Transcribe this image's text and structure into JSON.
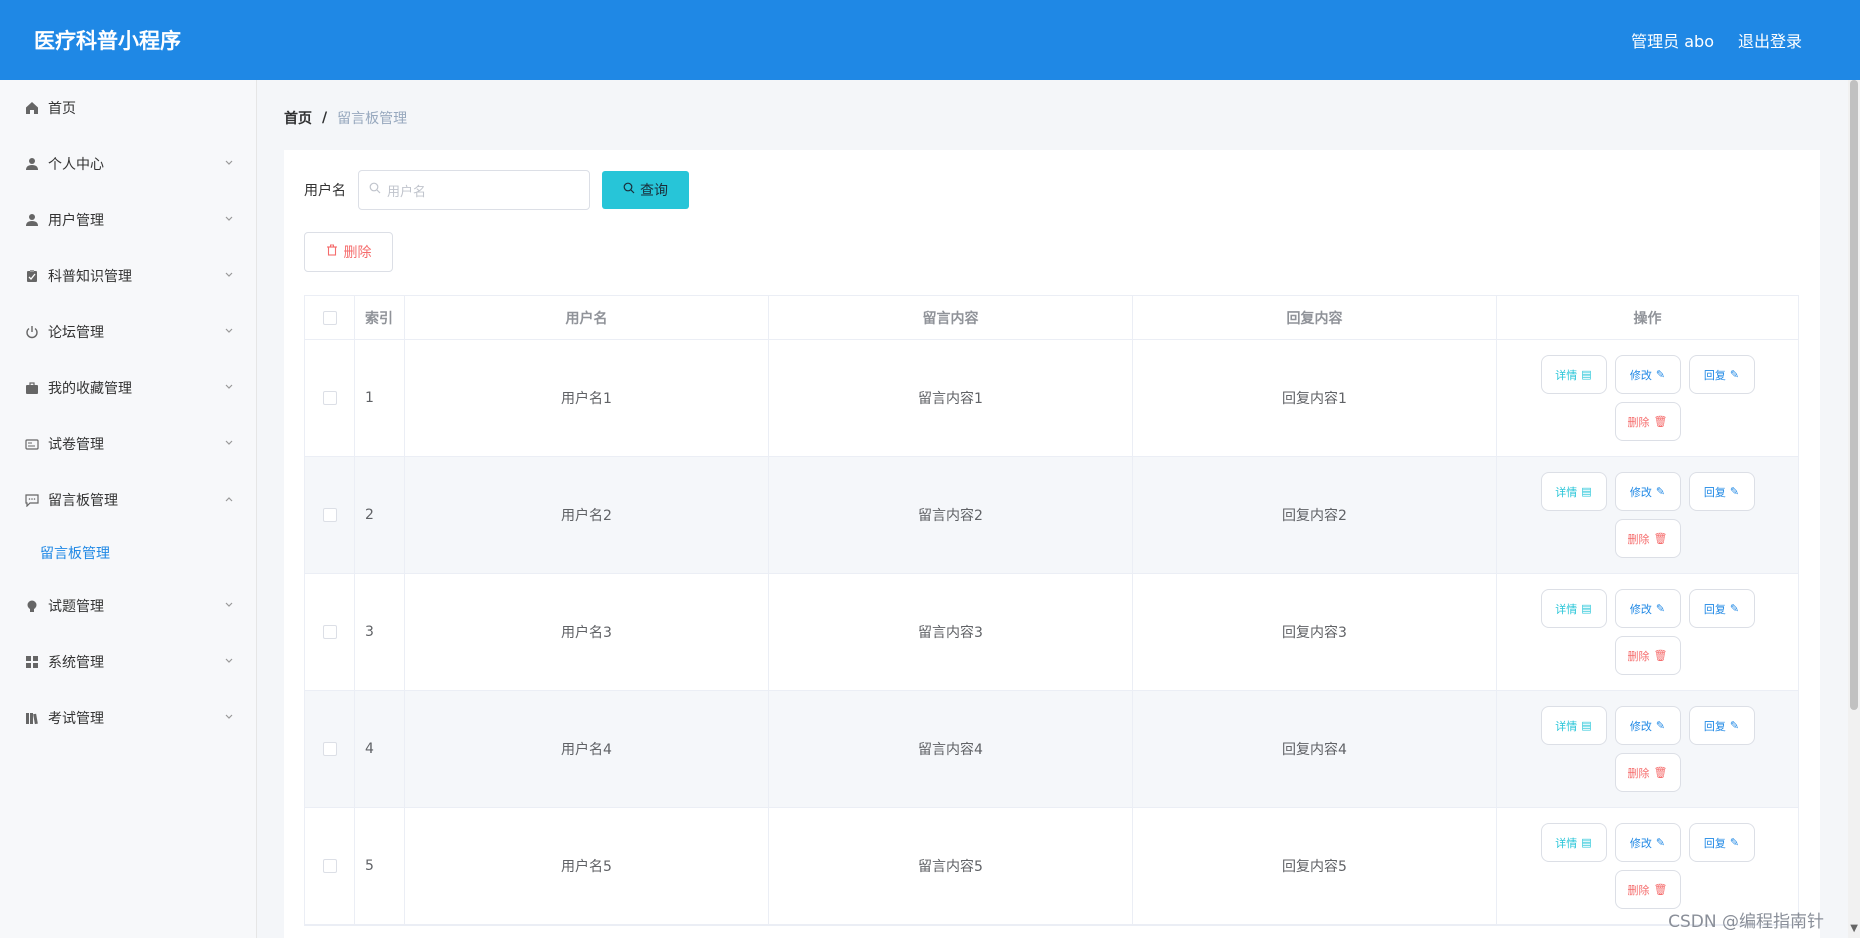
{
  "header": {
    "title": "医疗科普小程序",
    "admin": "管理员 abo",
    "logout": "退出登录"
  },
  "sidebar": {
    "items": [
      {
        "label": "首页",
        "icon": "home-icon"
      },
      {
        "label": "个人中心",
        "icon": "user-icon"
      },
      {
        "label": "用户管理",
        "icon": "user-icon"
      },
      {
        "label": "科普知识管理",
        "icon": "clipboard-icon"
      },
      {
        "label": "论坛管理",
        "icon": "power-icon"
      },
      {
        "label": "我的收藏管理",
        "icon": "briefcase-icon"
      },
      {
        "label": "试卷管理",
        "icon": "card-icon"
      },
      {
        "label": "留言板管理",
        "icon": "chat-icon"
      },
      {
        "label": "试题管理",
        "icon": "bulb-icon"
      },
      {
        "label": "系统管理",
        "icon": "grid-icon"
      },
      {
        "label": "考试管理",
        "icon": "books-icon"
      }
    ],
    "submenu": {
      "label": "留言板管理"
    }
  },
  "breadcrumb": {
    "home": "首页",
    "separator": "/",
    "current": "留言板管理"
  },
  "search": {
    "label": "用户名",
    "placeholder": "用户名",
    "button": "查询"
  },
  "toolbar": {
    "delete": "删除"
  },
  "table": {
    "headers": {
      "index": "索引",
      "username": "用户名",
      "message": "留言内容",
      "reply": "回复内容",
      "ops": "操作"
    },
    "rows": [
      {
        "index": "1",
        "username": "用户名1",
        "message": "留言内容1",
        "reply": "回复内容1"
      },
      {
        "index": "2",
        "username": "用户名2",
        "message": "留言内容2",
        "reply": "回复内容2"
      },
      {
        "index": "3",
        "username": "用户名3",
        "message": "留言内容3",
        "reply": "回复内容3"
      },
      {
        "index": "4",
        "username": "用户名4",
        "message": "留言内容4",
        "reply": "回复内容4"
      },
      {
        "index": "5",
        "username": "用户名5",
        "message": "留言内容5",
        "reply": "回复内容5"
      }
    ],
    "ops": {
      "detail": "详情",
      "edit": "修改",
      "reply": "回复",
      "delete": "删除"
    }
  },
  "watermark": "CSDN @编程指南针",
  "colors": {
    "header_bg": "#1f88e5",
    "query_btn": "#27c5d8",
    "danger": "#f56c6c",
    "link": "#1f88e5"
  }
}
